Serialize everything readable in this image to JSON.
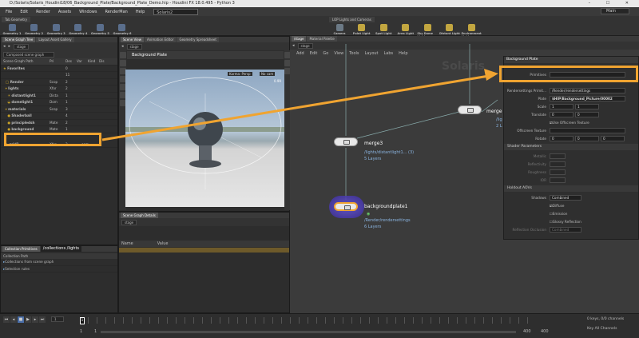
{
  "window": {
    "title": "D:/Solaris/Solaris_Houdini18/06_Background_Plate/Background_Plate_Demo.hip - Houdini FX 18.0.495 - Python 3",
    "controls": "–  ☐  ✕"
  },
  "menu": [
    "File",
    "Edit",
    "Render",
    "Assets",
    "Windows",
    "RenderMan",
    "Help"
  ],
  "desktop": "Solaris2",
  "main_desktop": "Main",
  "shelf": {
    "left_tab": "Tab Geometry",
    "tools": [
      "Geometry 1",
      "Geometry 2",
      "Geometry 3",
      "Geometry 4",
      "Geometry 5",
      "Geometry 6"
    ],
    "right_tab": "LOP Lights and Cameras",
    "light_tools": [
      "Camera",
      "Point Light",
      "Spot Light",
      "Area Light",
      "Sky Dome Light",
      "Distant Light",
      "Environment Light"
    ]
  },
  "scene_tree": {
    "tabs": [
      "Scene Graph Tree",
      "Layout Asset Gallery"
    ],
    "path": "stage",
    "filter": "Composed scene graph",
    "columns": [
      "Scene Graph Path",
      "Pri",
      "Des",
      "Var",
      "Kind",
      "Dis"
    ],
    "rows": [
      {
        "name": "Favorites",
        "type": "",
        "count": "0",
        "kind": ""
      },
      {
        "name": "",
        "type": "",
        "count": "11",
        "kind": ""
      },
      {
        "name": "Render",
        "type": "Scop",
        "count": "2",
        "kind": ""
      },
      {
        "name": "lights",
        "type": "Xfor",
        "count": "2",
        "kind": ""
      },
      {
        "name": "distantlight1",
        "type": "Dista",
        "count": "1",
        "kind": ""
      },
      {
        "name": "domelight1",
        "type": "Dom",
        "count": "1",
        "kind": ""
      },
      {
        "name": "materials",
        "type": "Scop",
        "count": "3",
        "kind": ""
      },
      {
        "name": "Shaderball",
        "type": "",
        "count": "4",
        "kind": ""
      },
      {
        "name": "principledsh",
        "type": "Mate",
        "count": "2",
        "kind": ""
      },
      {
        "name": "background",
        "type": "Mate",
        "count": "1",
        "kind": ""
      },
      {
        "name": "grid1",
        "type": "Xfor",
        "count": "2",
        "kind": "com"
      }
    ]
  },
  "collections": {
    "tab": "Collection Primitives",
    "path": "/collections /lights",
    "header": "Collection Path",
    "items": [
      "Collections from scene graph",
      "Selection rules"
    ]
  },
  "viewport": {
    "tabs": [
      "Scene View",
      "Animation Editor",
      "Geometry Spreadsheet"
    ],
    "path": "stage",
    "title": "Background Plate",
    "camera": "Karma: Persp",
    "cam2": "No cam",
    "fps": "0.99"
  },
  "details": {
    "tab": "Scene Graph Details",
    "path": "stage",
    "col_name": "Name",
    "col_value": "Value"
  },
  "network": {
    "tabs": [
      "/stage",
      "Material Palette"
    ],
    "path": "stage",
    "menu": [
      "Add",
      "Edit",
      "Go",
      "View",
      "Tools",
      "Layout",
      "Labs",
      "Help"
    ],
    "watermark": "Solaris",
    "nodes": [
      {
        "name": "merge3",
        "sub": [
          "/lights/distantlight1... (3)",
          "5 Layers"
        ]
      },
      {
        "name": "backgroundplate1",
        "sub": [
          "/Render/rendersettings",
          "6 Layers"
        ]
      },
      {
        "name": "merge",
        "sub": [
          "/lig",
          "2 L"
        ]
      }
    ]
  },
  "parm": {
    "title": "Background Plate",
    "primitives_label": "Primitives",
    "primitives_value": "",
    "rows": [
      {
        "label": "Rendersettings Primit...",
        "value": "/Render/rendersettings"
      },
      {
        "label": "Plate",
        "value": "$HIP/Background_Picture/00002"
      },
      {
        "label": "Scale",
        "value": "1"
      },
      {
        "label": "Translate",
        "value": "0"
      },
      {
        "label": "Rotate",
        "value": "0"
      }
    ],
    "use_offscreen": "Use Offscreen Texture",
    "offscreen_label": "Offscreen Texture",
    "shader_section": "Shader Parameters",
    "shader_rows": [
      "Metallic",
      "Reflectivity",
      "Roughness",
      "IOR"
    ],
    "holdout_section": "Holdout AOVs",
    "shadows_label": "Shadows",
    "shadows_value": "Combined",
    "checks": [
      "Diffuse",
      "Emission",
      "Glossy Reflection"
    ],
    "refl_occl_label": "Reflection Occlusion",
    "refl_occl_value": "Combined"
  },
  "timeline": {
    "frame": "1",
    "start": "1",
    "start2": "1",
    "end": "400",
    "end2": "400",
    "keys": "0 keys, 0/0 channels",
    "channels": "Key All Channels"
  },
  "accent": "#f0a431"
}
